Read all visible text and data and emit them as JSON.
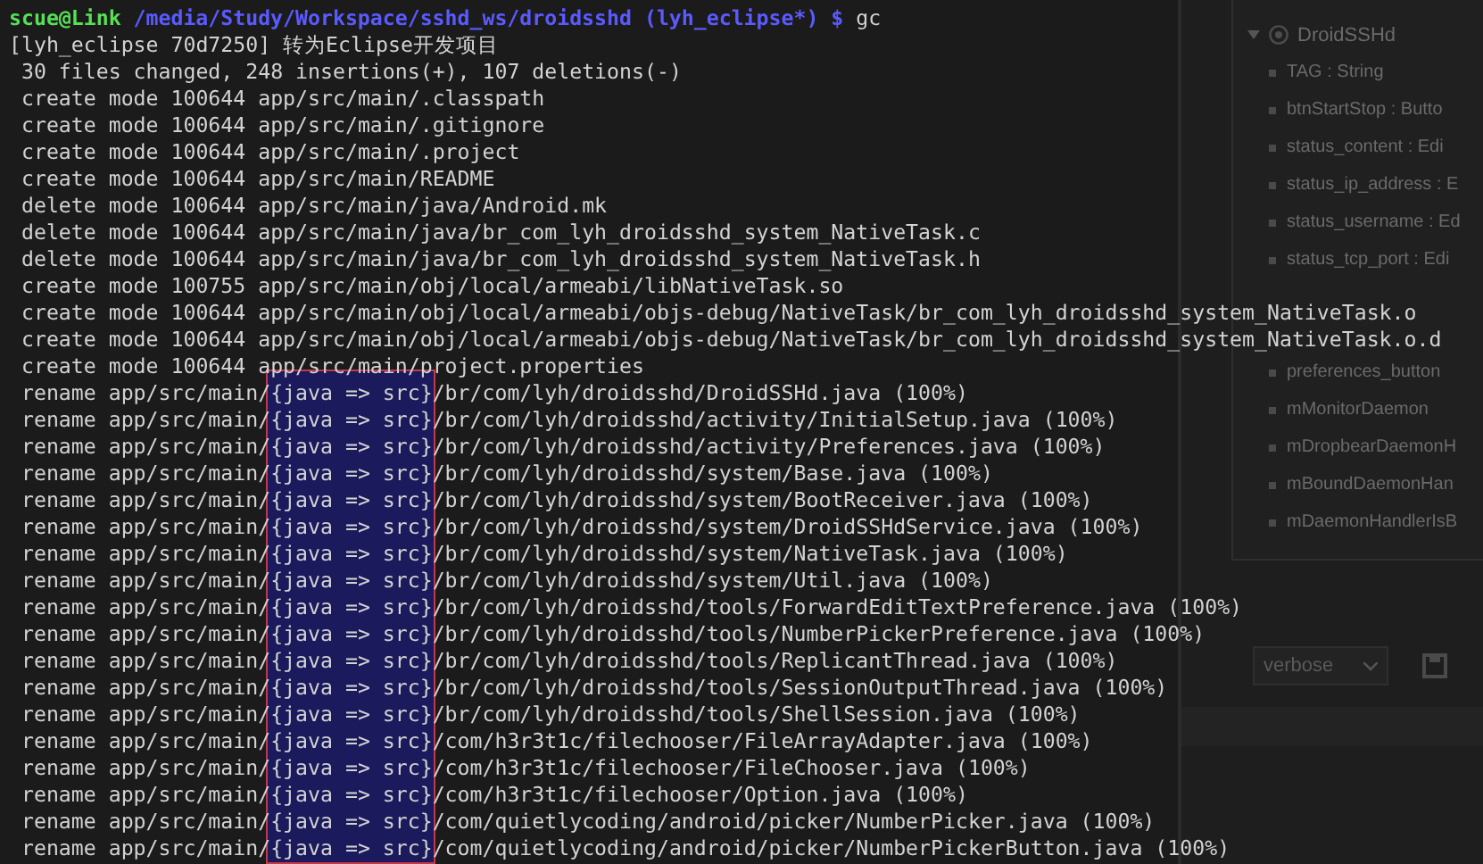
{
  "background_window": {
    "outline": {
      "class_name": "DroidSSHd",
      "expanded": true,
      "members_top": [
        "TAG : String",
        "btnStartStop : Butto",
        "status_content : Edi",
        "status_ip_address : E",
        "status_username : Ed",
        "status_tcp_port : Edi"
      ],
      "members_bottom": [
        "preferences_button",
        "mMonitorDaemon",
        "mDropbearDaemonH",
        "mBoundDaemonHan",
        "mDaemonHandlerIsB"
      ]
    },
    "log_level": "verbose"
  },
  "terminal": {
    "prompt": {
      "user_host": "scue@Link",
      "path": "/media/Study/Workspace/sshd_ws/droidsshd (lyh_eclipse*) $",
      "command": "gc"
    },
    "summary_lines": [
      "[lyh_eclipse 70d7250] 转为Eclipse开发项目",
      " 30 files changed, 248 insertions(+), 107 deletions(-)",
      " create mode 100644 app/src/main/.classpath",
      " create mode 100644 app/src/main/.gitignore",
      " create mode 100644 app/src/main/.project",
      " create mode 100644 app/src/main/README",
      " delete mode 100644 app/src/main/java/Android.mk",
      " delete mode 100644 app/src/main/java/br_com_lyh_droidsshd_system_NativeTask.c",
      " delete mode 100644 app/src/main/java/br_com_lyh_droidsshd_system_NativeTask.h",
      " create mode 100755 app/src/main/obj/local/armeabi/libNativeTask.so",
      " create mode 100644 app/src/main/obj/local/armeabi/objs-debug/NativeTask/br_com_lyh_droidsshd_system_NativeTask.o",
      " create mode 100644 app/src/main/obj/local/armeabi/objs-debug/NativeTask/br_com_lyh_droidsshd_system_NativeTask.o.d",
      " create mode 100644 app/src/main/project.properties"
    ],
    "rename_lines": [
      " rename app/src/main/{java => src}/br/com/lyh/droidsshd/DroidSSHd.java (100%)",
      " rename app/src/main/{java => src}/br/com/lyh/droidsshd/activity/InitialSetup.java (100%)",
      " rename app/src/main/{java => src}/br/com/lyh/droidsshd/activity/Preferences.java (100%)",
      " rename app/src/main/{java => src}/br/com/lyh/droidsshd/system/Base.java (100%)",
      " rename app/src/main/{java => src}/br/com/lyh/droidsshd/system/BootReceiver.java (100%)",
      " rename app/src/main/{java => src}/br/com/lyh/droidsshd/system/DroidSSHdService.java (100%)",
      " rename app/src/main/{java => src}/br/com/lyh/droidsshd/system/NativeTask.java (100%)",
      " rename app/src/main/{java => src}/br/com/lyh/droidsshd/system/Util.java (100%)",
      " rename app/src/main/{java => src}/br/com/lyh/droidsshd/tools/ForwardEditTextPreference.java (100%)",
      " rename app/src/main/{java => src}/br/com/lyh/droidsshd/tools/NumberPickerPreference.java (100%)",
      " rename app/src/main/{java => src}/br/com/lyh/droidsshd/tools/ReplicantThread.java (100%)",
      " rename app/src/main/{java => src}/br/com/lyh/droidsshd/tools/SessionOutputThread.java (100%)",
      " rename app/src/main/{java => src}/br/com/lyh/droidsshd/tools/ShellSession.java (100%)",
      " rename app/src/main/{java => src}/com/h3r3t1c/filechooser/FileArrayAdapter.java (100%)",
      " rename app/src/main/{java => src}/com/h3r3t1c/filechooser/FileChooser.java (100%)",
      " rename app/src/main/{java => src}/com/h3r3t1c/filechooser/Option.java (100%)",
      " rename app/src/main/{java => src}/com/quietlycoding/android/picker/NumberPicker.java (100%)",
      " rename app/src/main/{java => src}/com/quietlycoding/android/picker/NumberPickerButton.java (100%)"
    ]
  }
}
